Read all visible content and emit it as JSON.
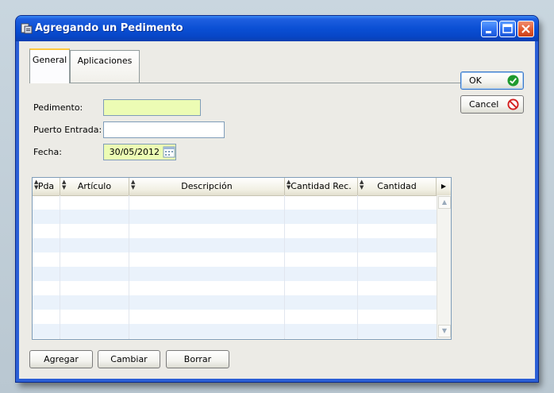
{
  "window": {
    "title": "Agregando un Pedimento"
  },
  "tabs": [
    {
      "label": "General",
      "active": true
    },
    {
      "label": "Aplicaciones",
      "active": false
    }
  ],
  "form": {
    "pedimento": {
      "label": "Pedimento:",
      "value": ""
    },
    "puerto_entrada": {
      "label": "Puerto Entrada:",
      "value": ""
    },
    "fecha": {
      "label": "Fecha:",
      "value": "30/05/2012"
    }
  },
  "grid": {
    "columns": [
      "Pda",
      "Artículo",
      "Descripción",
      "Cantidad Rec.",
      "Cantidad"
    ],
    "rows": []
  },
  "buttons": {
    "agregar": "Agregar",
    "cambiar": "Cambiar",
    "borrar": "Borrar",
    "ok": "OK",
    "cancel": "Cancel"
  },
  "colors": {
    "required_field_bg": "#ecfcb4",
    "title_bar": "#0a4fd4",
    "row_alt": "#eaf2fb"
  }
}
